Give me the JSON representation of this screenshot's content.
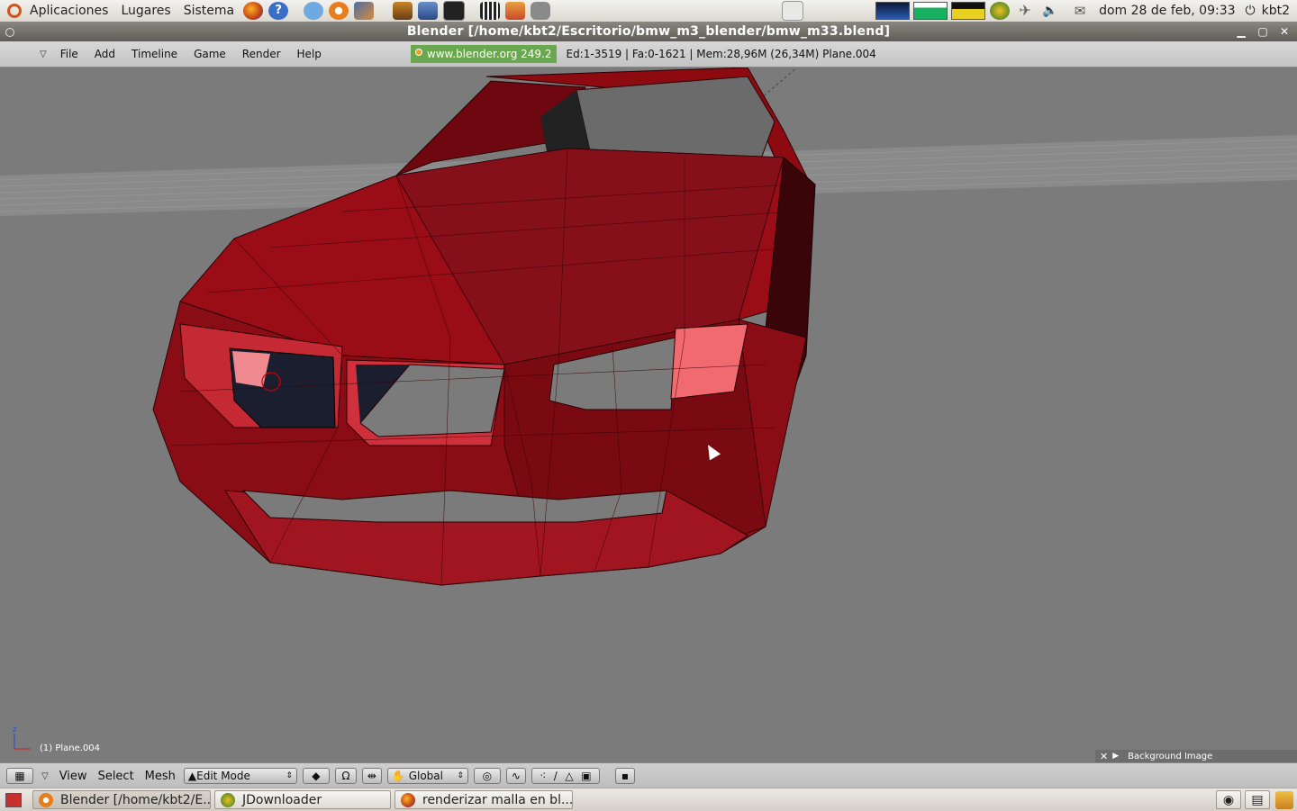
{
  "top_panel": {
    "menus": [
      "Aplicaciones",
      "Lugares",
      "Sistema"
    ],
    "clock": "dom 28 de feb, 09:33",
    "user": "kbt2"
  },
  "window": {
    "title": "Blender [/home/kbt2/Escritorio/bmw_m3_blender/bmw_m33.blend]",
    "minimize_icon": "minimize-icon",
    "maximize_icon": "maximize-icon",
    "close_icon": "close-icon"
  },
  "blender_header": {
    "menus": [
      "File",
      "Add",
      "Timeline",
      "Game",
      "Render",
      "Help"
    ],
    "version_badge": "www.blender.org 249.2",
    "stats": "Ed:1-3519 | Fa:0-1621 | Mem:28,96M (26,34M) Plane.004"
  },
  "viewport": {
    "object_label": "(1) Plane.004",
    "background_panel_label": "Background Image",
    "axis_x": "x",
    "axis_z": "z"
  },
  "bottom_header": {
    "menus": [
      "View",
      "Select",
      "Mesh"
    ],
    "mode": "Edit Mode",
    "orientation": "Global"
  },
  "taskbar": {
    "tasks": [
      {
        "label": "Blender [/home/kbt2/E...",
        "icon": "blender-icon"
      },
      {
        "label": "JDownloader",
        "icon": "jdownloader-icon"
      },
      {
        "label": "renderizar malla en bl...",
        "icon": "firefox-icon"
      }
    ]
  },
  "colors": {
    "mesh_red": "#8c0a10",
    "mesh_highlight": "#e84a52",
    "viewport_gray": "#7b7b7b",
    "badge_green": "#6aa84f"
  }
}
